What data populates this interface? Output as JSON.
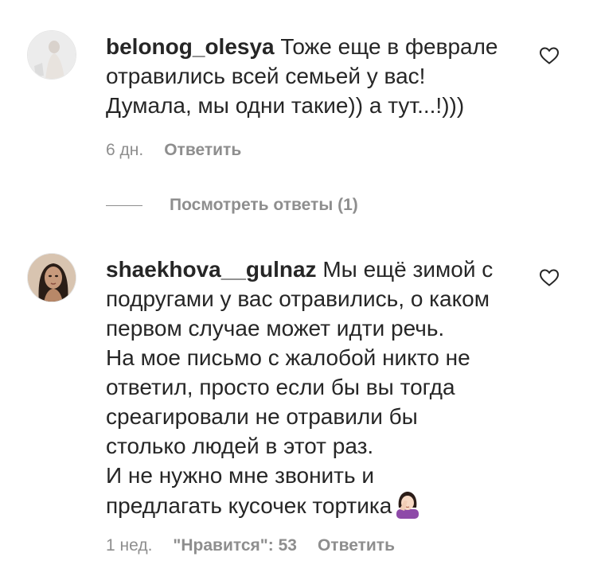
{
  "comments": [
    {
      "username": "belonog_olesya",
      "text": "Тоже еще в феврале\nотравились всей семьей у вас!\nДумала, мы одни такие)) а тут...!)))",
      "time": "6 дн.",
      "reply_label": "Ответить",
      "like_icon": "heart-outline-icon",
      "view_replies_label": "Посмотреть ответы (1)"
    },
    {
      "username": "shaekhova__gulnaz",
      "text": "Мы ещё зимой с\nподругами у вас отравились, о каком\nпервом случае может идти речь.\nНа мое письмо с жалобой никто не\nответил, просто если бы вы тогда\nсреагировали не отравили бы\nстолько людей в этот раз.\nИ не нужно мне звонить и\nпредлагать кусочек тортика",
      "emoji": "facepalm-woman-emoji",
      "time": "1 нед.",
      "likes_label": "\"Нравится\": 53",
      "reply_label": "Ответить",
      "like_icon": "heart-outline-icon"
    }
  ],
  "colors": {
    "text": "#262626",
    "secondary": "#8e8e8e",
    "background": "#ffffff"
  }
}
